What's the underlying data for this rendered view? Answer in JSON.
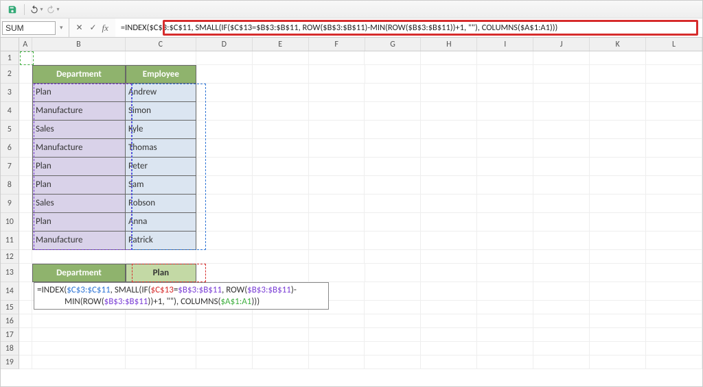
{
  "qat": {
    "save_tip": "Save",
    "undo_tip": "Undo",
    "redo_tip": "Redo"
  },
  "namebox": {
    "value": "SUM"
  },
  "formula_bar": {
    "cancel_tip": "Cancel",
    "enter_tip": "Enter",
    "fx_label": "fx",
    "formula": "=INDEX($C$3:$C$11, SMALL(IF($C$13=$B$3:$B$11, ROW($B$3:$B$11)-MIN(ROW($B$3:$B$11))+1, \"\"), COLUMNS($A$1:A1)))"
  },
  "columns": [
    "A",
    "B",
    "C",
    "D",
    "E",
    "F",
    "G",
    "H",
    "I",
    "J",
    "K",
    "L"
  ],
  "row_numbers": [
    1,
    2,
    3,
    4,
    5,
    6,
    7,
    8,
    9,
    10,
    11,
    12,
    13,
    14,
    15,
    16,
    17,
    18,
    19
  ],
  "table": {
    "headers": {
      "dep": "Department",
      "emp": "Employee"
    },
    "rows": [
      {
        "dep": "Plan",
        "emp": "Andrew"
      },
      {
        "dep": "Manufacture",
        "emp": "Simon"
      },
      {
        "dep": "Sales",
        "emp": "Kyle"
      },
      {
        "dep": "Manufacture",
        "emp": "Thomas"
      },
      {
        "dep": "Plan",
        "emp": "Peter"
      },
      {
        "dep": "Plan",
        "emp": "Sam"
      },
      {
        "dep": "Sales",
        "emp": "Robson"
      },
      {
        "dep": "Plan",
        "emp": "Anna"
      },
      {
        "dep": "Manufacture",
        "emp": "Patrick"
      }
    ]
  },
  "lookup": {
    "label": "Department",
    "value": "Plan"
  },
  "cell_formula": {
    "line1_pre": "=INDEX(",
    "line1_r1": "$C$3:$C$11",
    "line1_mid1": ", SMALL(IF(",
    "line1_r2": "$C$13",
    "line1_mid2": "=",
    "line1_r3": "$B$3:$B$11",
    "line1_mid3": ", ROW(",
    "line1_r4": "$B$3:$B$11",
    "line1_post": ")-",
    "line2_pre": "MIN(ROW(",
    "line2_r1": "$B$3:$B$11",
    "line2_mid1": "))+1, \"\"), COLUMNS(",
    "line2_r2": "$A$1:A1",
    "line2_post": ")))"
  }
}
